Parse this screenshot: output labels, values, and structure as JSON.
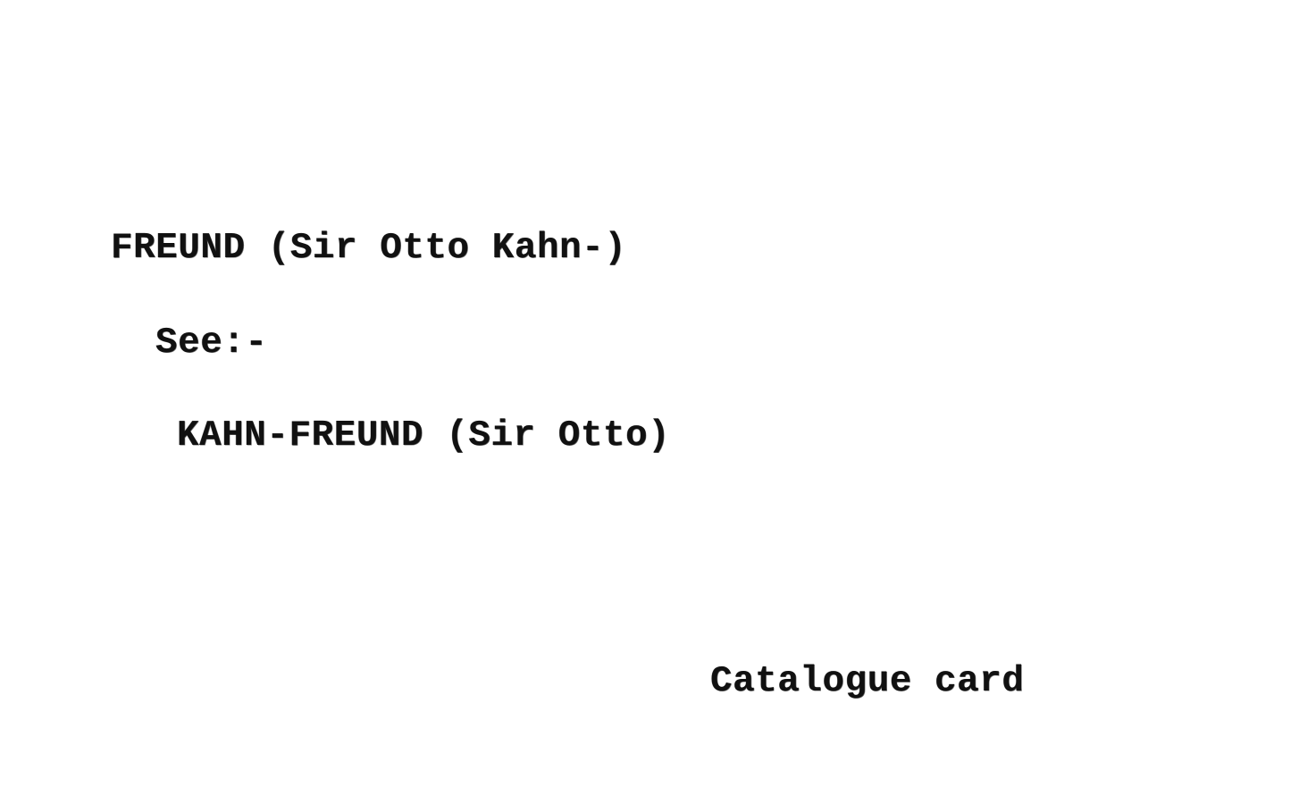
{
  "card": {
    "heading": "FREUND (Sir Otto Kahn-)",
    "see_label": "See:-",
    "reference": "KAHN-FREUND (Sir Otto)",
    "footer_note": "Catalogue card"
  }
}
